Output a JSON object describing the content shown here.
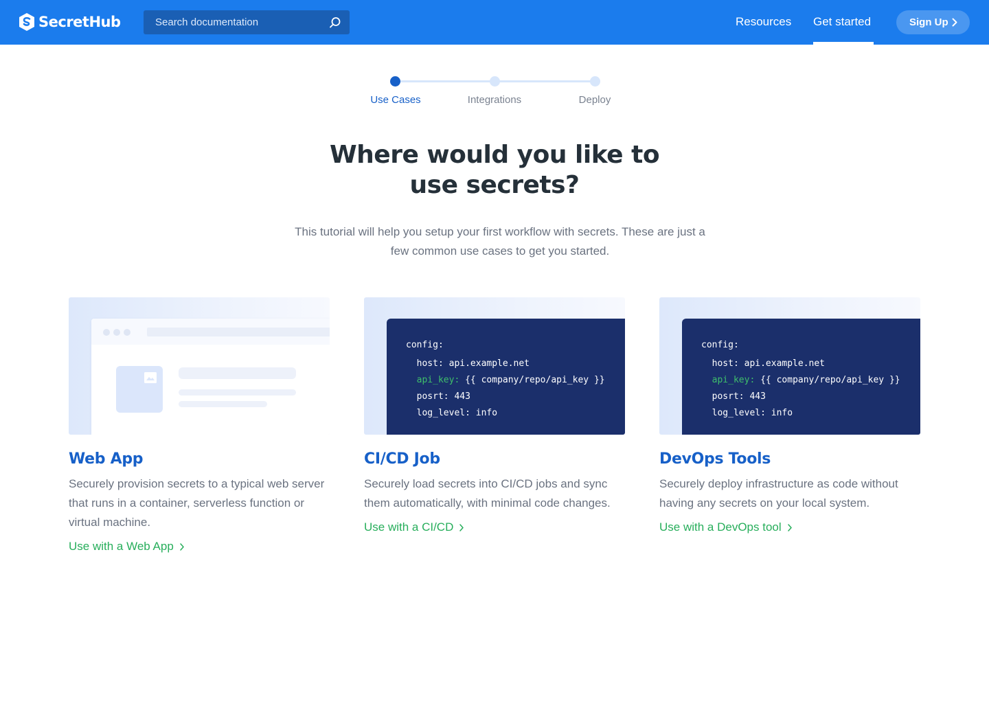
{
  "header": {
    "brand": "SecretHub",
    "search_placeholder": "Search documentation",
    "nav": [
      {
        "label": "Resources"
      },
      {
        "label": "Get started"
      }
    ],
    "signup_label": "Sign Up",
    "colors": {
      "bar": "#1b7ced",
      "search": "#1a5fb4",
      "signup": "#4a97f0"
    }
  },
  "stepper": {
    "steps": [
      {
        "label": "Use Cases",
        "state": "active"
      },
      {
        "label": "Integrations",
        "state": "inactive"
      },
      {
        "label": "Deploy",
        "state": "inactive"
      }
    ]
  },
  "hero": {
    "title_line1": "Where would you like to",
    "title_line2": "use secrets?",
    "subtitle": "This tutorial will help you setup your first workflow with secrets. These are just a few common use cases to get you started."
  },
  "cards": [
    {
      "title": "Web App",
      "description": "Securely provision secrets to a typical web server that runs in a container, serverless function or virtual machine.",
      "link": "Use with a Web App"
    },
    {
      "title": "CI/CD Job",
      "description": "Securely load secrets into CI/CD jobs and sync them automatically, with minimal code changes.",
      "link": "Use with a CI/CD",
      "code": {
        "l1": "config:",
        "l2": "  host: api.example.net",
        "l3_key": "  api_key:",
        "l3_val": " {{ company/repo/api_key }}",
        "l4": "  posrt: 443",
        "l5": "  log_level: info"
      }
    },
    {
      "title": "DevOps Tools",
      "description": "Securely deploy infrastructure as code without having any secrets on your local system.",
      "link": "Use with a DevOps tool",
      "code": {
        "l1": "config:",
        "l2": "  host: api.example.net",
        "l3_key": "  api_key:",
        "l3_val": " {{ company/repo/api_key }}",
        "l4": "  posrt: 443",
        "l5": "  log_level: info"
      }
    }
  ]
}
